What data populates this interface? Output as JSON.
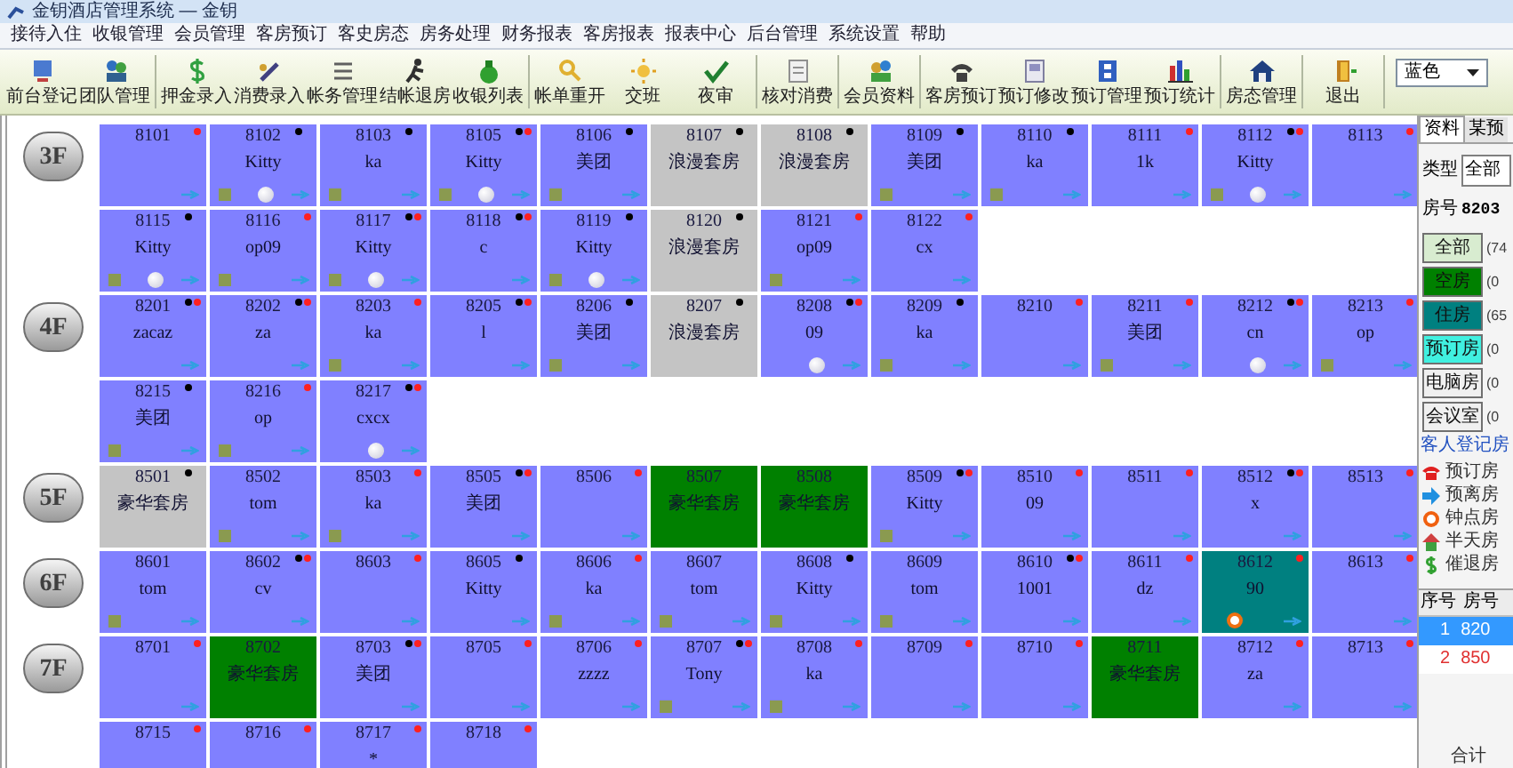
{
  "window": {
    "title": "金钥酒店管理系统 — 金钥"
  },
  "menu": [
    "接待入住",
    "收银管理",
    "会员管理",
    "客房预订",
    "客史房态",
    "房务处理",
    "财务报表",
    "客房报表",
    "报表中心",
    "后台管理",
    "系统设置",
    "帮助"
  ],
  "toolbar": {
    "groups": [
      [
        "前台登记",
        "团队管理"
      ],
      [
        "押金录入",
        "消费录入",
        "帐务管理",
        "结帐退房",
        "收银列表"
      ],
      [
        "帐单重开",
        "交班",
        "夜审"
      ],
      [
        "核对消费"
      ],
      [
        "会员资料"
      ],
      [
        "客房预订",
        "预订修改",
        "预订管理",
        "预订统计"
      ],
      [
        "房态管理"
      ],
      [
        "退出"
      ]
    ],
    "theme_select": "蓝色"
  },
  "floors": [
    {
      "label": "3F",
      "rooms": [
        {
          "number": "8101",
          "color": "#8080ff",
          "black_dot": false,
          "red_dot": true,
          "square": false,
          "ball": false,
          "arrow": true,
          "alarm": false
        },
        {
          "number": "8102",
          "guest": "Kitty",
          "color": "#8080ff",
          "black_dot": true,
          "red_dot": false,
          "square": true,
          "ball": true,
          "arrow": true,
          "alarm": false
        },
        {
          "number": "8103",
          "guest": "ka",
          "color": "#8080ff",
          "black_dot": true,
          "red_dot": false,
          "square": true,
          "ball": false,
          "arrow": true,
          "alarm": false
        },
        {
          "number": "8105",
          "guest": "Kitty",
          "color": "#8080ff",
          "black_dot": true,
          "red_dot": true,
          "square": true,
          "ball": true,
          "arrow": true,
          "alarm": false
        },
        {
          "number": "8106",
          "guest": "美团",
          "color": "#8080ff",
          "black_dot": true,
          "red_dot": false,
          "square": true,
          "ball": false,
          "arrow": true,
          "alarm": false
        },
        {
          "number": "8107",
          "guest": "浪漫套房",
          "color": "#c4c4c4",
          "black_dot": true,
          "red_dot": false,
          "square": false,
          "ball": false,
          "arrow": false,
          "alarm": false
        },
        {
          "number": "8108",
          "guest": "浪漫套房",
          "color": "#c4c4c4",
          "black_dot": true,
          "red_dot": false,
          "square": false,
          "ball": false,
          "arrow": false,
          "alarm": false
        },
        {
          "number": "8109",
          "guest": "美团",
          "color": "#8080ff",
          "black_dot": true,
          "red_dot": false,
          "square": true,
          "ball": false,
          "arrow": true,
          "alarm": false
        },
        {
          "number": "8110",
          "guest": "ka",
          "color": "#8080ff",
          "black_dot": true,
          "red_dot": false,
          "square": true,
          "ball": false,
          "arrow": true,
          "alarm": false
        },
        {
          "number": "8111",
          "guest": "1k",
          "color": "#8080ff",
          "black_dot": false,
          "red_dot": true,
          "square": false,
          "ball": false,
          "arrow": true,
          "alarm": false
        },
        {
          "number": "8112",
          "guest": "Kitty",
          "color": "#8080ff",
          "black_dot": true,
          "red_dot": true,
          "square": true,
          "ball": true,
          "arrow": true,
          "alarm": false
        },
        {
          "number": "8113",
          "color": "#8080ff",
          "black_dot": false,
          "red_dot": true,
          "square": false,
          "ball": false,
          "arrow": true,
          "alarm": false
        },
        {
          "number": "8115",
          "guest": "Kitty",
          "color": "#8080ff",
          "black_dot": true,
          "red_dot": false,
          "square": true,
          "ball": true,
          "arrow": true,
          "alarm": false
        },
        {
          "number": "8116",
          "guest": "op09",
          "color": "#8080ff",
          "black_dot": false,
          "red_dot": true,
          "square": true,
          "ball": false,
          "arrow": true,
          "alarm": false
        },
        {
          "number": "8117",
          "guest": "Kitty",
          "color": "#8080ff",
          "black_dot": true,
          "red_dot": true,
          "square": true,
          "ball": true,
          "arrow": true,
          "alarm": false
        },
        {
          "number": "8118",
          "guest": "c",
          "color": "#8080ff",
          "black_dot": true,
          "red_dot": true,
          "square": false,
          "ball": false,
          "arrow": true,
          "alarm": false
        },
        {
          "number": "8119",
          "guest": "Kitty",
          "color": "#8080ff",
          "black_dot": true,
          "red_dot": false,
          "square": true,
          "ball": true,
          "arrow": true,
          "alarm": false
        },
        {
          "number": "8120",
          "guest": "浪漫套房",
          "color": "#c4c4c4",
          "black_dot": true,
          "red_dot": false,
          "square": false,
          "ball": false,
          "arrow": false,
          "alarm": false
        },
        {
          "number": "8121",
          "guest": "op09",
          "color": "#8080ff",
          "black_dot": false,
          "red_dot": true,
          "square": true,
          "ball": false,
          "arrow": true,
          "alarm": false
        },
        {
          "number": "8122",
          "guest": "cx",
          "color": "#8080ff",
          "black_dot": false,
          "red_dot": true,
          "square": false,
          "ball": false,
          "arrow": true,
          "alarm": false
        }
      ]
    },
    {
      "label": "4F",
      "rooms": [
        {
          "number": "8201",
          "guest": "zacaz",
          "color": "#8080ff",
          "black_dot": true,
          "red_dot": true,
          "square": false,
          "ball": false,
          "arrow": true,
          "alarm": false
        },
        {
          "number": "8202",
          "guest": "za",
          "color": "#8080ff",
          "black_dot": true,
          "red_dot": true,
          "square": false,
          "ball": false,
          "arrow": true,
          "alarm": false
        },
        {
          "number": "8203",
          "guest": "ka",
          "color": "#8080ff",
          "black_dot": false,
          "red_dot": true,
          "square": true,
          "ball": false,
          "arrow": true,
          "alarm": false
        },
        {
          "number": "8205",
          "guest": "l",
          "color": "#8080ff",
          "black_dot": true,
          "red_dot": true,
          "square": false,
          "ball": false,
          "arrow": true,
          "alarm": false
        },
        {
          "number": "8206",
          "guest": "美团",
          "color": "#8080ff",
          "black_dot": true,
          "red_dot": false,
          "square": true,
          "ball": false,
          "arrow": true,
          "alarm": false
        },
        {
          "number": "8207",
          "guest": "浪漫套房",
          "color": "#c4c4c4",
          "black_dot": true,
          "red_dot": false,
          "square": false,
          "ball": false,
          "arrow": false,
          "alarm": false
        },
        {
          "number": "8208",
          "guest": "09",
          "color": "#8080ff",
          "black_dot": true,
          "red_dot": true,
          "square": false,
          "ball": true,
          "arrow": true,
          "alarm": false
        },
        {
          "number": "8209",
          "guest": "ka",
          "color": "#8080ff",
          "black_dot": true,
          "red_dot": false,
          "square": true,
          "ball": false,
          "arrow": true,
          "alarm": false
        },
        {
          "number": "8210",
          "color": "#8080ff",
          "black_dot": false,
          "red_dot": true,
          "square": false,
          "ball": false,
          "arrow": true,
          "alarm": false
        },
        {
          "number": "8211",
          "guest": "美团",
          "color": "#8080ff",
          "black_dot": false,
          "red_dot": true,
          "square": true,
          "ball": false,
          "arrow": true,
          "alarm": false
        },
        {
          "number": "8212",
          "guest": "cn",
          "color": "#8080ff",
          "black_dot": true,
          "red_dot": true,
          "square": false,
          "ball": true,
          "arrow": true,
          "alarm": false
        },
        {
          "number": "8213",
          "guest": "op",
          "color": "#8080ff",
          "black_dot": false,
          "red_dot": true,
          "square": true,
          "ball": false,
          "arrow": true,
          "alarm": false
        },
        {
          "number": "8215",
          "guest": "美团",
          "color": "#8080ff",
          "black_dot": true,
          "red_dot": false,
          "square": true,
          "ball": false,
          "arrow": true,
          "alarm": false
        },
        {
          "number": "8216",
          "guest": "op",
          "color": "#8080ff",
          "black_dot": false,
          "red_dot": true,
          "square": true,
          "ball": false,
          "arrow": true,
          "alarm": false
        },
        {
          "number": "8217",
          "guest": "cxcx",
          "color": "#8080ff",
          "black_dot": true,
          "red_dot": true,
          "square": false,
          "ball": true,
          "arrow": true,
          "alarm": false
        }
      ]
    },
    {
      "label": "5F",
      "rooms": [
        {
          "number": "8501",
          "guest": "豪华套房",
          "color": "#c4c4c4",
          "black_dot": true,
          "red_dot": false,
          "square": false,
          "ball": false,
          "arrow": false,
          "alarm": false
        },
        {
          "number": "8502",
          "guest": "tom",
          "color": "#8080ff",
          "black_dot": false,
          "red_dot": false,
          "square": true,
          "ball": false,
          "arrow": true,
          "alarm": false
        },
        {
          "number": "8503",
          "guest": "ka",
          "color": "#8080ff",
          "black_dot": false,
          "red_dot": true,
          "square": true,
          "ball": false,
          "arrow": true,
          "alarm": false
        },
        {
          "number": "8505",
          "guest": "美团",
          "color": "#8080ff",
          "black_dot": true,
          "red_dot": true,
          "square": false,
          "ball": false,
          "arrow": true,
          "alarm": false
        },
        {
          "number": "8506",
          "color": "#8080ff",
          "black_dot": false,
          "red_dot": true,
          "square": false,
          "ball": false,
          "arrow": true,
          "alarm": false
        },
        {
          "number": "8507",
          "guest": "豪华套房",
          "color": "#008000",
          "black_dot": false,
          "red_dot": false,
          "square": false,
          "ball": false,
          "arrow": false,
          "alarm": false
        },
        {
          "number": "8508",
          "guest": "豪华套房",
          "color": "#008000",
          "black_dot": false,
          "red_dot": false,
          "square": false,
          "ball": false,
          "arrow": false,
          "alarm": false
        },
        {
          "number": "8509",
          "guest": "Kitty",
          "color": "#8080ff",
          "black_dot": true,
          "red_dot": true,
          "square": true,
          "ball": false,
          "arrow": true,
          "alarm": false
        },
        {
          "number": "8510",
          "guest": "09",
          "color": "#8080ff",
          "black_dot": false,
          "red_dot": true,
          "square": false,
          "ball": false,
          "arrow": true,
          "alarm": false
        },
        {
          "number": "8511",
          "color": "#8080ff",
          "black_dot": false,
          "red_dot": true,
          "square": false,
          "ball": false,
          "arrow": true,
          "alarm": false
        },
        {
          "number": "8512",
          "guest": "x",
          "color": "#8080ff",
          "black_dot": true,
          "red_dot": true,
          "square": false,
          "ball": false,
          "arrow": true,
          "alarm": false
        },
        {
          "number": "8513",
          "color": "#8080ff",
          "black_dot": false,
          "red_dot": true,
          "square": false,
          "ball": false,
          "arrow": true,
          "alarm": false
        }
      ]
    },
    {
      "label": "6F",
      "rooms": [
        {
          "number": "8601",
          "guest": "tom",
          "color": "#8080ff",
          "black_dot": false,
          "red_dot": false,
          "square": true,
          "ball": false,
          "arrow": true,
          "alarm": false
        },
        {
          "number": "8602",
          "guest": "cv",
          "color": "#8080ff",
          "black_dot": true,
          "red_dot": true,
          "square": false,
          "ball": false,
          "arrow": true,
          "alarm": false
        },
        {
          "number": "8603",
          "color": "#8080ff",
          "black_dot": false,
          "red_dot": true,
          "square": false,
          "ball": false,
          "arrow": true,
          "alarm": false
        },
        {
          "number": "8605",
          "guest": "Kitty",
          "color": "#8080ff",
          "black_dot": true,
          "red_dot": false,
          "square": false,
          "ball": false,
          "arrow": true,
          "alarm": false
        },
        {
          "number": "8606",
          "guest": "ka",
          "color": "#8080ff",
          "black_dot": false,
          "red_dot": true,
          "square": true,
          "ball": false,
          "arrow": true,
          "alarm": false
        },
        {
          "number": "8607",
          "guest": "tom",
          "color": "#8080ff",
          "black_dot": false,
          "red_dot": false,
          "square": true,
          "ball": false,
          "arrow": true,
          "alarm": false
        },
        {
          "number": "8608",
          "guest": "Kitty",
          "color": "#8080ff",
          "black_dot": true,
          "red_dot": false,
          "square": true,
          "ball": false,
          "arrow": true,
          "alarm": false
        },
        {
          "number": "8609",
          "guest": "tom",
          "color": "#8080ff",
          "black_dot": false,
          "red_dot": false,
          "square": true,
          "ball": false,
          "arrow": true,
          "alarm": false
        },
        {
          "number": "8610",
          "guest": "1001",
          "color": "#8080ff",
          "black_dot": true,
          "red_dot": true,
          "square": false,
          "ball": false,
          "arrow": true,
          "alarm": false
        },
        {
          "number": "8611",
          "guest": "dz",
          "color": "#8080ff",
          "black_dot": false,
          "red_dot": true,
          "square": false,
          "ball": false,
          "arrow": true,
          "alarm": false
        },
        {
          "number": "8612",
          "guest": "90",
          "color": "#008080",
          "black_dot": false,
          "red_dot": true,
          "square": false,
          "ball": false,
          "arrow": true,
          "alarm": true
        },
        {
          "number": "8613",
          "color": "#8080ff",
          "black_dot": false,
          "red_dot": true,
          "square": false,
          "ball": false,
          "arrow": true,
          "alarm": false
        }
      ]
    },
    {
      "label": "7F",
      "rooms": [
        {
          "number": "8701",
          "color": "#8080ff",
          "black_dot": false,
          "red_dot": true,
          "square": false,
          "ball": false,
          "arrow": true,
          "alarm": false
        },
        {
          "number": "8702",
          "guest": "豪华套房",
          "color": "#008000",
          "black_dot": false,
          "red_dot": false,
          "square": false,
          "ball": false,
          "arrow": false,
          "alarm": false
        },
        {
          "number": "8703",
          "guest": "美团",
          "color": "#8080ff",
          "black_dot": true,
          "red_dot": true,
          "square": false,
          "ball": false,
          "arrow": true,
          "alarm": false
        },
        {
          "number": "8705",
          "color": "#8080ff",
          "black_dot": false,
          "red_dot": true,
          "square": false,
          "ball": false,
          "arrow": true,
          "alarm": false
        },
        {
          "number": "8706",
          "guest": "zzzz",
          "color": "#8080ff",
          "black_dot": false,
          "red_dot": true,
          "square": false,
          "ball": false,
          "arrow": true,
          "alarm": false
        },
        {
          "number": "8707",
          "guest": "Tony",
          "color": "#8080ff",
          "black_dot": true,
          "red_dot": true,
          "square": true,
          "ball": false,
          "arrow": true,
          "alarm": false
        },
        {
          "number": "8708",
          "guest": "ka",
          "color": "#8080ff",
          "black_dot": false,
          "red_dot": true,
          "square": true,
          "ball": false,
          "arrow": true,
          "alarm": false
        },
        {
          "number": "8709",
          "color": "#8080ff",
          "black_dot": false,
          "red_dot": true,
          "square": false,
          "ball": false,
          "arrow": true,
          "alarm": false
        },
        {
          "number": "8710",
          "color": "#8080ff",
          "black_dot": false,
          "red_dot": true,
          "square": false,
          "ball": false,
          "arrow": true,
          "alarm": false
        },
        {
          "number": "8711",
          "guest": "豪华套房",
          "color": "#008000",
          "black_dot": false,
          "red_dot": false,
          "square": false,
          "ball": false,
          "arrow": false,
          "alarm": false
        },
        {
          "number": "8712",
          "guest": "za",
          "color": "#8080ff",
          "black_dot": false,
          "red_dot": true,
          "square": false,
          "ball": false,
          "arrow": true,
          "alarm": false
        },
        {
          "number": "8713",
          "color": "#8080ff",
          "black_dot": false,
          "red_dot": true,
          "square": false,
          "ball": false,
          "arrow": true,
          "alarm": false
        },
        {
          "number": "8715",
          "color": "#8080ff",
          "black_dot": false,
          "red_dot": true
        },
        {
          "number": "8716",
          "color": "#8080ff",
          "black_dot": false,
          "red_dot": true
        },
        {
          "number": "8717",
          "guest": "*",
          "color": "#8080ff",
          "black_dot": false,
          "red_dot": true
        },
        {
          "number": "8718",
          "color": "#8080ff",
          "black_dot": false,
          "red_dot": true
        }
      ]
    }
  ],
  "side_panel": {
    "tabs": [
      {
        "label": "资料",
        "selected": true
      },
      {
        "label": "某预",
        "selected": false
      }
    ],
    "type_label": "类型",
    "type_value": "全部",
    "room_label": "房号",
    "room_value": "8203",
    "filters": [
      {
        "label": "全部",
        "count": "(74",
        "color": "#d8ecd0"
      },
      {
        "label": "空房",
        "count": "(0",
        "color": "#008000"
      },
      {
        "label": "住房",
        "count": "(65",
        "color": "#008080"
      },
      {
        "label": "预订房",
        "count": "(0",
        "color": "#40f0e0"
      },
      {
        "label": "电脑房",
        "count": "(0",
        "color": "#f0f0f0"
      },
      {
        "label": "会议室",
        "count": "(0",
        "color": "#f0f0f0"
      }
    ],
    "link": "客人登记房",
    "legend": [
      {
        "kind": "phone",
        "label": "预订房"
      },
      {
        "kind": "arrow",
        "label": "预离房"
      },
      {
        "kind": "clock",
        "label": "钟点房"
      },
      {
        "kind": "house",
        "label": "半天房"
      },
      {
        "kind": "dollar",
        "label": "催退房"
      }
    ],
    "table": {
      "columns": [
        "序号",
        "房号"
      ],
      "rows": [
        {
          "cells": [
            "1",
            "820"
          ],
          "selected": true
        },
        {
          "cells": [
            "2",
            "850"
          ],
          "selected": false
        }
      ]
    },
    "total": "合计"
  }
}
